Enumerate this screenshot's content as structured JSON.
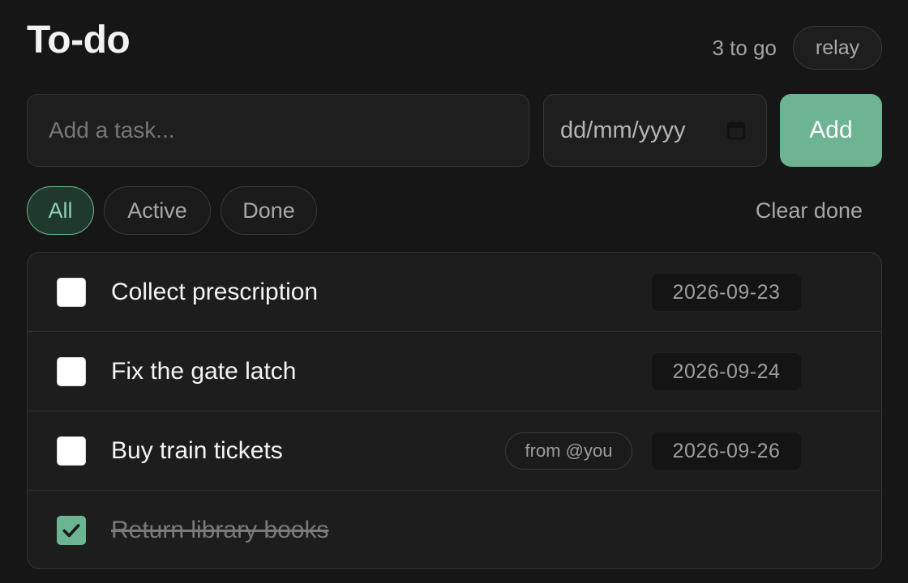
{
  "header": {
    "title": "To-do",
    "remaining": "3 to go",
    "relay_label": "relay"
  },
  "composer": {
    "task_placeholder": "Add a task...",
    "date_placeholder": "dd/mm/yyyy",
    "add_label": "Add"
  },
  "filters": [
    {
      "label": "All",
      "active": true
    },
    {
      "label": "Active",
      "active": false
    },
    {
      "label": "Done",
      "active": false
    }
  ],
  "clear_done_label": "Clear done",
  "tasks": [
    {
      "label": "Collect prescription",
      "due": "2026-09-23",
      "from": "",
      "done": false
    },
    {
      "label": "Fix the gate latch",
      "due": "2026-09-24",
      "from": "",
      "done": false
    },
    {
      "label": "Buy train tickets",
      "due": "2026-09-26",
      "from": "from @you",
      "done": false
    },
    {
      "label": "Return library books",
      "due": "",
      "from": "",
      "done": true
    }
  ],
  "colors": {
    "accent": "#6db493",
    "background": "#161616",
    "surface": "#1d1d1d"
  },
  "icons": {
    "date_picker": "calendar-icon",
    "checked": "checkmark-icon"
  }
}
